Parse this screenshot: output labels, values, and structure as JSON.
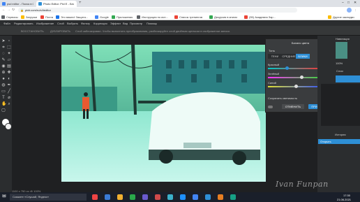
{
  "browser": {
    "tabs": [
      {
        "title": "psd editor - Поиск в Google",
        "color": "#4285f4",
        "active": false
      },
      {
        "title": "Photo Editor: Pixl E - Бесплатн...",
        "color": "#2e8fd6",
        "active": true
      },
      {
        "title": "+",
        "color": "",
        "active": false
      }
    ],
    "url": "pixlr.com/ru/x/#editor",
    "bookmarks": [
      {
        "label": "Сервисы",
        "color": "#5f6368"
      },
      {
        "label": "Загрузки",
        "color": "#fbbc04"
      },
      {
        "label": "Почта",
        "color": "#ea4335"
      },
      {
        "label": "Это важно! Защита...",
        "color": "#1a73e8"
      },
      {
        "label": "Google",
        "color": "#4285f4"
      },
      {
        "label": "Приложения",
        "color": "#34a853"
      },
      {
        "label": "Инструкция по исп...",
        "color": "#5f6368"
      },
      {
        "label": "Список тренингов",
        "color": "#ea4335"
      },
      {
        "label": "Декурсия в книгах",
        "color": "#34a853"
      },
      {
        "label": "(55) Академия Зар...",
        "color": "#ea4335"
      },
      {
        "label": "Другие закладки",
        "color": "#fbbc04"
      }
    ]
  },
  "menubar": {
    "items": [
      "Файл",
      "Редактировать",
      "Изображение",
      "Слой",
      "Выбрать",
      "Фильтр",
      "Коррекция",
      "Эффект",
      "Вид",
      "Просмотр",
      "Помощь"
    ]
  },
  "optbar": {
    "left_label": "ВОССТАНОВИТЬ",
    "left2_label": "ДУБЛИРОВАТЬ",
    "hint": "Слой заблокирован. Чтобы выполнить преобразования, разблокируйте слой двойным щелчком в изображении записи."
  },
  "dialog": {
    "title": "Баланс цвета",
    "ranges_label": "Тоны",
    "range_options": [
      {
        "label": "ТЕНИ",
        "active": false
      },
      {
        "label": "СРЕДНИЕ",
        "active": false
      },
      {
        "label": "БЛИКИ",
        "active": true
      }
    ],
    "sliders": [
      {
        "label": "Красный",
        "value": "-73",
        "fraction": 0.34
      },
      {
        "label": "Зелёный",
        "value": "+18",
        "fraction": 0.6
      },
      {
        "label": "Синий",
        "value": "0",
        "fraction": 0.5
      }
    ],
    "preserve_label": "Сохранить светимость",
    "cancel_label": "ОТМЕНИТЬ",
    "apply_label": "ПРИМЕНИТЬ"
  },
  "rightpanel": {
    "navigator_label": "Навигация",
    "zoom_value": "100%",
    "layers_label": "Слои",
    "history_label": "История",
    "history_item": "Открыть"
  },
  "status": {
    "size_text": "1100 x 750 px @ 100%"
  },
  "watermark": "Ivan Funpan",
  "taskbar": {
    "search_placeholder": "Скажите «Слушай, Яндекс»",
    "time": "17:30",
    "date": "21.06.2021"
  },
  "colors": {
    "accent": "#2e8fd6",
    "apply_button": "#2e8fd6",
    "photo_tint": "#2a8a7a"
  }
}
